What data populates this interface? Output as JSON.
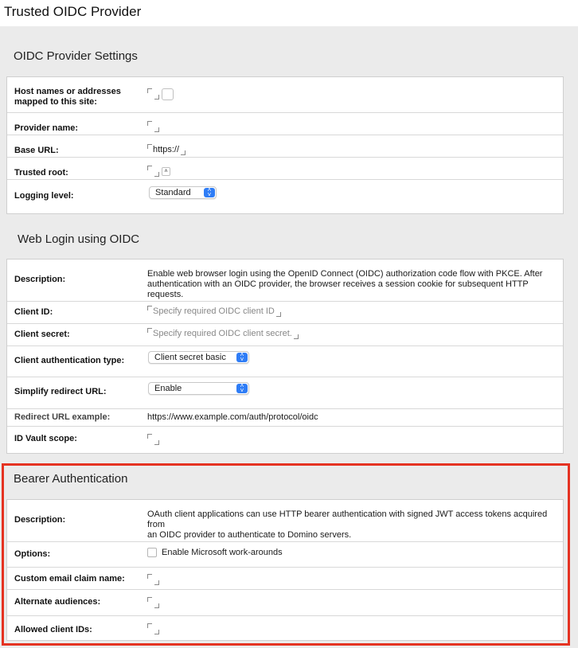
{
  "window": {
    "title": "Trusted OIDC Provider"
  },
  "oidc_provider_settings": {
    "title": "OIDC Provider Settings",
    "rows": [
      {
        "label_line1": "Host names or addresses",
        "label_line2": "mapped to this site:"
      },
      {
        "label": "Provider name:"
      },
      {
        "label": "Base URL:",
        "value": "https://"
      },
      {
        "label": "Trusted root:"
      },
      {
        "label": "Logging level:",
        "select_value": "Standard"
      }
    ]
  },
  "web_login": {
    "title": "Web Login using OIDC",
    "description_label": "Description:",
    "description_line1": "Enable web browser login using the OpenID Connect (OIDC) authorization code flow with PKCE. After",
    "description_line2": "authentication with an OIDC provider, the browser receives a session cookie for subsequent HTTP requests.",
    "client_id_label": "Client ID:",
    "client_id_placeholder": "Specify required OIDC client ID",
    "client_secret_label": "Client secret:",
    "client_secret_placeholder": "Specify required OIDC client secret.",
    "client_auth_type_label": "Client authentication type:",
    "client_auth_type_value": "Client secret basic",
    "simplify_redirect_label": "Simplify redirect URL:",
    "simplify_redirect_value": "Enable",
    "redirect_example_label": "Redirect URL example:",
    "redirect_example_value": "https://www.example.com/auth/protocol/oidc",
    "id_vault_scope_label": "ID Vault scope:"
  },
  "bearer_auth": {
    "title": "Bearer Authentication",
    "description_label": "Description:",
    "description_line1": "OAuth client applications can use HTTP bearer authentication with signed JWT access tokens acquired from",
    "description_line2": "an OIDC provider to authenticate to Domino servers.",
    "options_label": "Options:",
    "option_ms_workarounds": "Enable Microsoft work-arounds",
    "option_ms_workarounds_checked": false,
    "custom_email_claim_label": "Custom email claim name:",
    "alternate_audiences_label": "Alternate audiences:",
    "allowed_client_ids_label": "Allowed client IDs:"
  },
  "colors": {
    "accent": "#2f7df6",
    "highlight": "#e53322",
    "panel_bg": "#ebebeb"
  }
}
